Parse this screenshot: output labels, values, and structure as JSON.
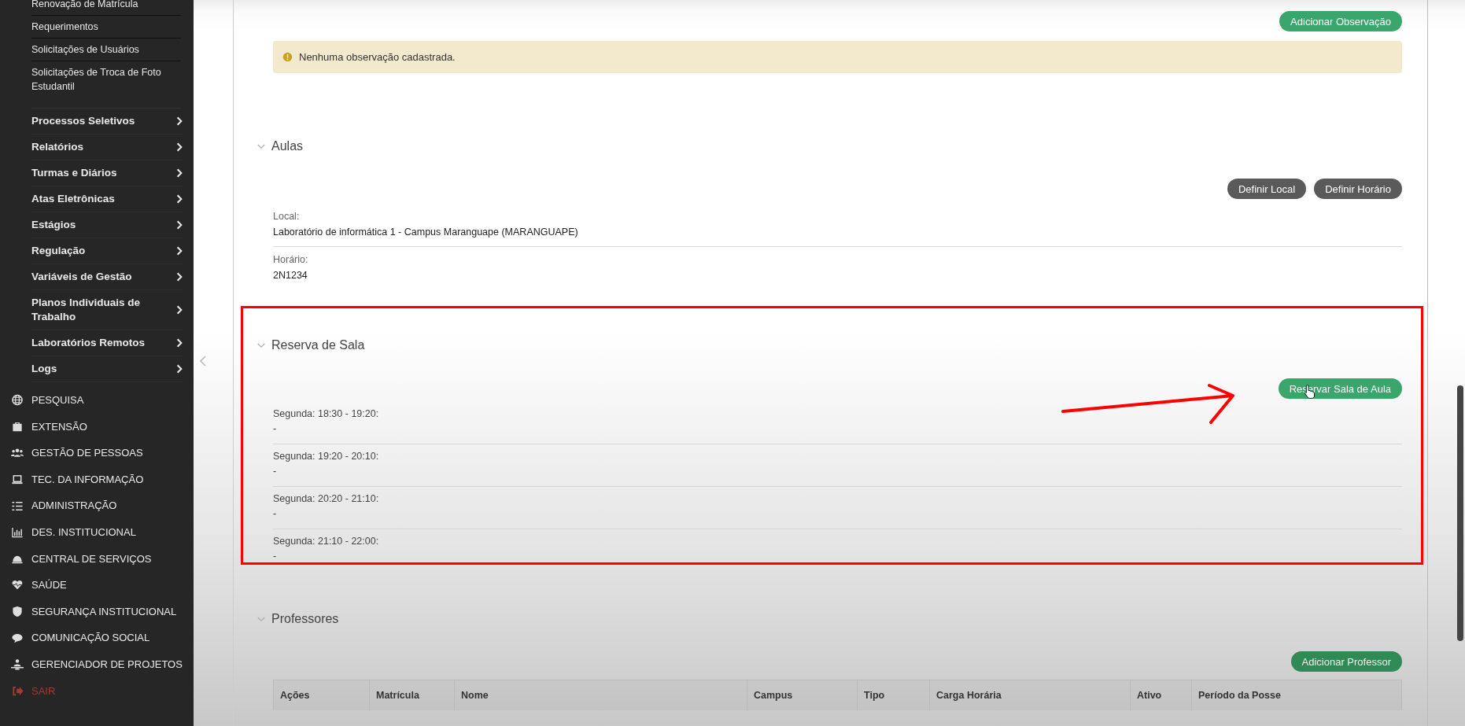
{
  "sidebar": {
    "submenu_items": [
      "Renovação de Matrícula",
      "Requerimentos",
      "Solicitações de Usuários",
      "Solicitações de Troca de Foto Estudantil"
    ],
    "menu_items": [
      "Processos Seletivos",
      "Relatórios",
      "Turmas e Diários",
      "Atas Eletrônicas",
      "Estágios",
      "Regulação",
      "Variáveis de Gestão",
      "Planos Individuais de Trabalho",
      "Laboratórios Remotos",
      "Logs"
    ],
    "modules": [
      {
        "label": "PESQUISA",
        "kind": "module"
      },
      {
        "label": "EXTENSÃO",
        "kind": "module"
      },
      {
        "label": "GESTÃO DE PESSOAS",
        "kind": "module"
      },
      {
        "label": "TEC. DA INFORMAÇÃO",
        "kind": "module"
      },
      {
        "label": "ADMINISTRAÇÃO",
        "kind": "module"
      },
      {
        "label": "DES. INSTITUCIONAL",
        "kind": "module"
      },
      {
        "label": "CENTRAL DE SERVIÇOS",
        "kind": "module"
      },
      {
        "label": "SAÚDE",
        "kind": "module"
      },
      {
        "label": "SEGURANÇA INSTITUCIONAL",
        "kind": "module"
      },
      {
        "label": "COMUNICAÇÃO SOCIAL",
        "kind": "module"
      },
      {
        "label": "GERENCIADOR DE PROJETOS",
        "kind": "module"
      },
      {
        "label": "SAIR",
        "kind": "logout"
      }
    ]
  },
  "observacoes": {
    "button": "Adicionar Observação",
    "alert": "Nenhuma observação cadastrada."
  },
  "aulas": {
    "title": "Aulas",
    "expanded": true,
    "buttons": [
      "Definir Local",
      "Definir Horário"
    ],
    "fields": [
      {
        "label": "Local:",
        "value": "Laboratório de informática 1 - Campus Maranguape (MARANGUAPE)"
      },
      {
        "label": "Horário:",
        "value": "2N1234"
      }
    ]
  },
  "reserva": {
    "title": "Reserva de Sala",
    "expanded": true,
    "button": "Reservar Sala de Aula",
    "slots": [
      {
        "label": "Segunda: 18:30 - 19:20:",
        "value": "-"
      },
      {
        "label": "Segunda: 19:20 - 20:10:",
        "value": "-"
      },
      {
        "label": "Segunda: 20:20 - 21:10:",
        "value": "-"
      },
      {
        "label": "Segunda: 21:10 - 22:00:",
        "value": "-"
      }
    ]
  },
  "professores": {
    "title": "Professores",
    "expanded": true,
    "button": "Adicionar Professor",
    "table": {
      "columns": [
        "Ações",
        "Matrícula",
        "Nome",
        "Campus",
        "Tipo",
        "Carga Horária",
        "Ativo",
        "Período da Posse"
      ]
    }
  }
}
